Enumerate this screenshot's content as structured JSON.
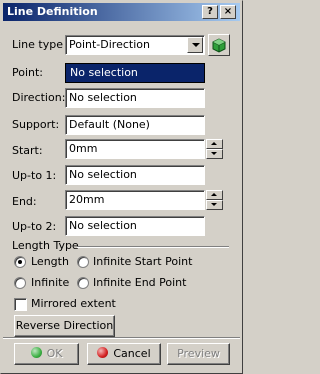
{
  "window": {
    "title": "Line Definition",
    "help_label": "?",
    "close_label": "×"
  },
  "form": {
    "line_type": {
      "label": "Line type :",
      "value": "Point-Direction"
    },
    "point": {
      "label": "Point:",
      "value": "No selection"
    },
    "direction": {
      "label": "Direction:",
      "value": "No selection"
    },
    "support": {
      "label": "Support:",
      "value": "Default (None)"
    },
    "start": {
      "label": "Start:",
      "value": "0mm"
    },
    "upto1": {
      "label": "Up-to 1:",
      "value": "No selection"
    },
    "end": {
      "label": "End:",
      "value": "20mm"
    },
    "upto2": {
      "label": "Up-to 2:",
      "value": "No selection"
    }
  },
  "length_type": {
    "label": "Length Type",
    "options": [
      {
        "label": "Length",
        "selected": true
      },
      {
        "label": "Infinite Start Point",
        "selected": false
      },
      {
        "label": "Infinite",
        "selected": false
      },
      {
        "label": "Infinite End Point",
        "selected": false
      }
    ]
  },
  "mirrored": {
    "label": "Mirrored extent",
    "checked": false
  },
  "reverse_button": "Reverse Direction",
  "buttons": {
    "ok": "OK",
    "cancel": "Cancel",
    "preview": "Preview"
  },
  "colors": {
    "title_start": "#0a246a",
    "title_end": "#a6caf0",
    "ok_dot": "#3cb043",
    "cancel_dot": "#d42020"
  }
}
